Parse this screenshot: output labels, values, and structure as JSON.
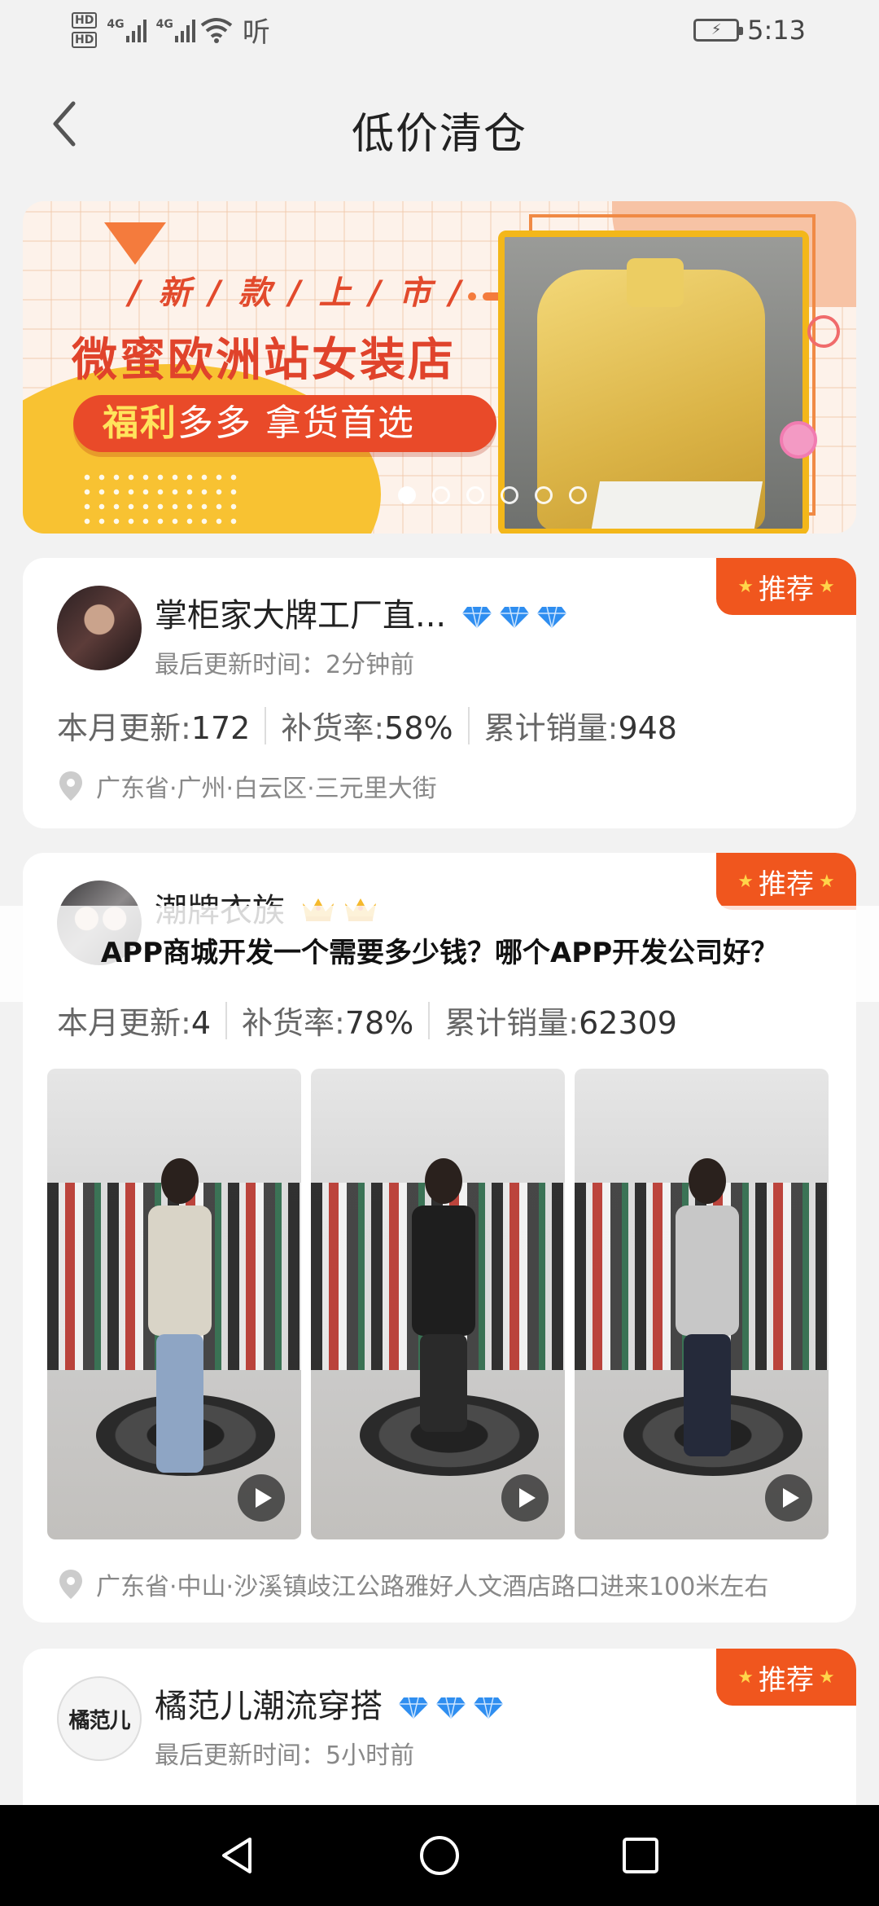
{
  "status_bar": {
    "hd1": "HD",
    "hd2": "HD",
    "net1": "4G",
    "net2": "4G",
    "extra": "听",
    "time": "5:13"
  },
  "header": {
    "title": "低价清仓"
  },
  "banner": {
    "subtitle": "/ 新 / 款 / 上 / 市 /",
    "title": "微蜜欧洲站女装店",
    "pill_highlight": "福利",
    "pill_rest": "多多 拿货首选",
    "page_count": 6,
    "active_page": 1
  },
  "cards": [
    {
      "name": "掌柜家大牌工厂直...",
      "rank_icon": "diamond-icon",
      "rank_count": 3,
      "updated": "最后更新时间：2分钟前",
      "badge": "推荐",
      "stats": [
        {
          "label": "本月更新:",
          "value": "172"
        },
        {
          "label": "补货率:",
          "value": "58%"
        },
        {
          "label": "累计销量:",
          "value": "948"
        }
      ],
      "address": "广东省·广州·白云区·三元里大街"
    },
    {
      "name": "潮牌衣族",
      "rank_icon": "crown-icon",
      "rank_count": 2,
      "badge": "推荐",
      "stats": [
        {
          "label": "本月更新:",
          "value": "4"
        },
        {
          "label": "补货率:",
          "value": "78%"
        },
        {
          "label": "累计销量:",
          "value": "62309"
        }
      ],
      "address": "广东省·中山·沙溪镇歧江公路雅好人文酒店路口进来100米左右"
    },
    {
      "name": "橘范儿潮流穿搭",
      "avatar_text": "橘范儿",
      "rank_icon": "diamond-icon",
      "rank_count": 3,
      "updated": "最后更新时间：5小时前",
      "badge": "推荐"
    }
  ],
  "overlay_caption": "APP商城开发一个需要多少钱？哪个APP开发公司好？",
  "colors": {
    "accent": "#f0561e",
    "badge_star": "#ffd54a",
    "gem": "#2f8ef0",
    "crown": "#f5b92e"
  }
}
